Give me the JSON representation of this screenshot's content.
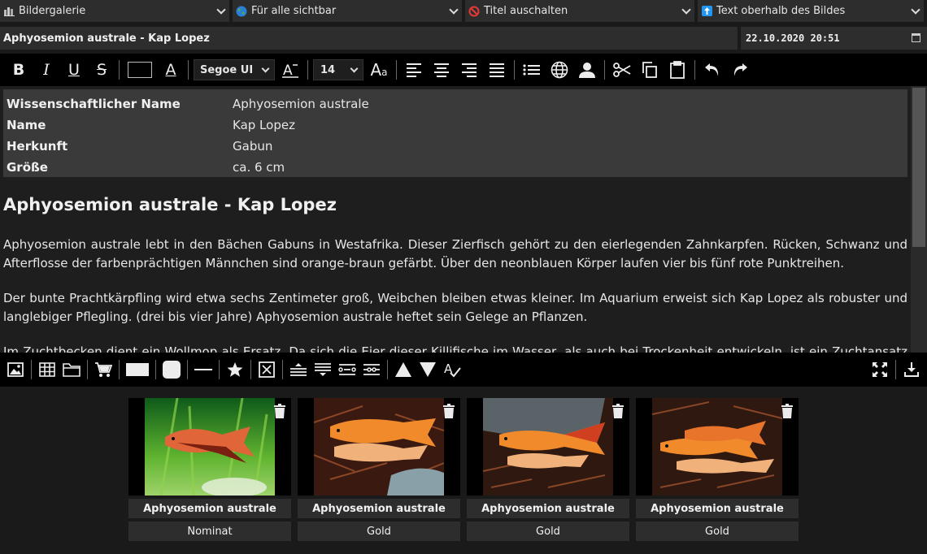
{
  "top_selects": [
    {
      "icon": "gallery-icon",
      "label": "Bildergalerie"
    },
    {
      "icon": "globe-icon",
      "label": "Für alle sichtbar"
    },
    {
      "icon": "no-entry-icon",
      "label": "Titel auschalten"
    },
    {
      "icon": "arrow-up-icon",
      "label": "Text oberhalb des Bildes"
    }
  ],
  "title": "Aphyosemion australe - Kap Lopez",
  "datetime": "22.10.2020 20:51",
  "toolbar": {
    "font": "Segoe UI",
    "size": "14"
  },
  "info_table": [
    {
      "key": "Wissenschaftlicher Name",
      "value": "Aphyosemion australe"
    },
    {
      "key": "Name",
      "value": "Kap Lopez"
    },
    {
      "key": "Herkunft",
      "value": "Gabun"
    },
    {
      "key": "Größe",
      "value": "ca. 6 cm"
    }
  ],
  "article": {
    "heading": "Aphyosemion australe - Kap Lopez",
    "p1": "Aphyosemion australe lebt in den Bächen Gabuns in Westafrika. Dieser Zierfisch gehört zu den eierlegenden Zahnkarpfen. Rücken, Schwanz und Afterflosse der farbenprächtigen Männchen sind orange-braun gefärbt. Über den neonblauen Körper laufen vier bis fünf rote Punktreihen.",
    "p2": "Der bunte Prachtkärpfling wird etwa sechs Zentimeter groß, Weibchen bleiben etwas kleiner. Im Aquarium erweist sich Kap Lopez als robuster und langlebiger Pflegling. (drei bis vier Jahre) Aphyosemion australe heftet sein Gelege an Pflanzen.",
    "p3": "Im Zuchtbecken dient ein Wollmop als Ersatz. Da sich die Eier dieser Killifische im Wasser, als auch bei Trockenheit entwickeln, ist ein Zuchtansatz auch"
  },
  "gallery": [
    {
      "name": "Aphyosemion australe",
      "variant": "Nominat"
    },
    {
      "name": "Aphyosemion australe",
      "variant": "Gold"
    },
    {
      "name": "Aphyosemion australe",
      "variant": "Gold"
    },
    {
      "name": "Aphyosemion australe",
      "variant": "Gold"
    }
  ]
}
